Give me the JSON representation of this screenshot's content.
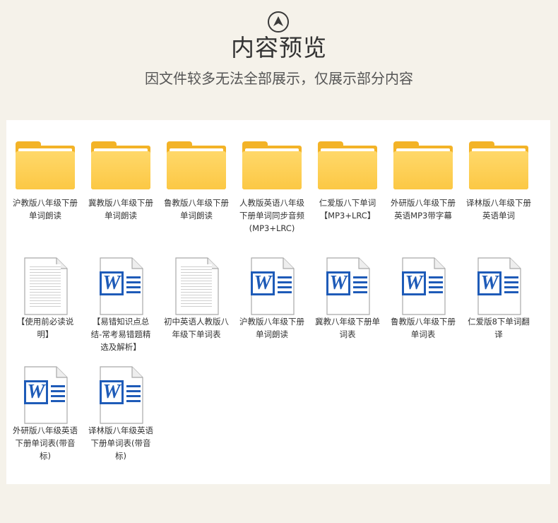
{
  "header": {
    "icon": "chevron-up-circle-icon",
    "title": "内容预览",
    "subtitle": "因文件较多无法全部展示，仅展示部分内容"
  },
  "files": [
    {
      "type": "folder",
      "label": "沪教版八年级下册单词朗读"
    },
    {
      "type": "folder",
      "label": "冀教版八年级下册单词朗读"
    },
    {
      "type": "folder",
      "label": "鲁教版八年级下册单词朗读"
    },
    {
      "type": "folder",
      "label": "人教版英语八年级下册单词同步音频(MP3+LRC)"
    },
    {
      "type": "folder",
      "label": "仁爱版八下单词【MP3+LRC】"
    },
    {
      "type": "folder",
      "label": "外研版八年级下册英语MP3带字幕"
    },
    {
      "type": "folder",
      "label": "译林版八年级下册英语单词"
    },
    {
      "type": "text",
      "label": "【使用前必读说明】"
    },
    {
      "type": "word",
      "label": "【易错知识点总结-常考易错题精选及解析】"
    },
    {
      "type": "text",
      "label": "初中英语人教版八年级下单词表"
    },
    {
      "type": "word",
      "label": "沪教版八年级下册单词朗读"
    },
    {
      "type": "word",
      "label": "冀教八年级下册单词表"
    },
    {
      "type": "word",
      "label": "鲁教版八年级下册单词表"
    },
    {
      "type": "word",
      "label": "仁爱版8下单词翻译"
    },
    {
      "type": "word",
      "label": "外研版八年级英语下册单词表(带音标)"
    },
    {
      "type": "word",
      "label": "译林版八年级英语下册单词表(带音标)"
    }
  ],
  "word_icon_letter": "W",
  "colors": {
    "folder": "#fcc844",
    "word_blue": "#1e5bb8",
    "background": "#f5f2ea"
  }
}
